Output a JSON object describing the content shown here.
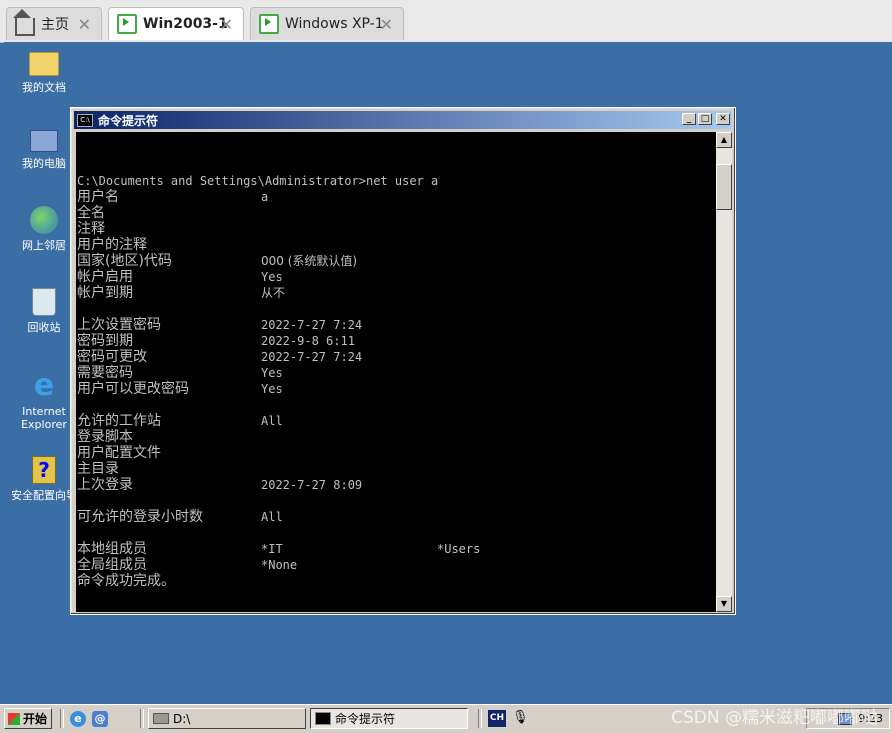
{
  "vm_tabs": [
    {
      "label": "主页",
      "icon": "home-icon",
      "active": false
    },
    {
      "label": "Win2003-1",
      "icon": "vm-icon",
      "active": true
    },
    {
      "label": "Windows XP-1",
      "icon": "vm-icon",
      "active": false
    }
  ],
  "desktop_icons": [
    {
      "label": "我的文档",
      "icon": "my-documents-icon"
    },
    {
      "label": "我的电脑",
      "icon": "my-computer-icon"
    },
    {
      "label": "网上邻居",
      "icon": "network-places-icon"
    },
    {
      "label": "回收站",
      "icon": "recycle-bin-icon"
    },
    {
      "label": "Internet Explorer",
      "icon": "internet-explorer-icon"
    },
    {
      "label": "安全配置向导",
      "icon": "security-wizard-icon"
    }
  ],
  "cmd": {
    "title": "命令提示符",
    "icon_text": "C:\\",
    "prompt_line": "C:\\Documents and Settings\\Administrator>net user a",
    "rows": [
      {
        "label": "用户名",
        "value": "a"
      },
      {
        "label": "全名",
        "value": ""
      },
      {
        "label": "注释",
        "value": ""
      },
      {
        "label": "用户的注释",
        "value": ""
      },
      {
        "label": "国家(地区)代码",
        "value": "000 (系统默认值)"
      },
      {
        "label": "帐户启用",
        "value": "Yes"
      },
      {
        "label": "帐户到期",
        "value": "从不"
      },
      {
        "label": "",
        "value": ""
      },
      {
        "label": "上次设置密码",
        "value": "2022-7-27 7:24"
      },
      {
        "label": "密码到期",
        "value": "2022-9-8 6:11"
      },
      {
        "label": "密码可更改",
        "value": "2022-7-27 7:24"
      },
      {
        "label": "需要密码",
        "value": "Yes"
      },
      {
        "label": "用户可以更改密码",
        "value": "Yes"
      },
      {
        "label": "",
        "value": ""
      },
      {
        "label": "允许的工作站",
        "value": "All"
      },
      {
        "label": "登录脚本",
        "value": ""
      },
      {
        "label": "用户配置文件",
        "value": ""
      },
      {
        "label": "主目录",
        "value": ""
      },
      {
        "label": "上次登录",
        "value": "2022-7-27 8:09"
      },
      {
        "label": "",
        "value": ""
      },
      {
        "label": "可允许的登录小时数",
        "value": "All"
      },
      {
        "label": "",
        "value": ""
      },
      {
        "label": "本地组成员",
        "value": "*IT",
        "value2": "*Users"
      },
      {
        "label": "全局组成员",
        "value": "*None"
      },
      {
        "label": "命令成功完成。",
        "value": ""
      }
    ]
  },
  "taskbar": {
    "start_label": "开始",
    "buttons": [
      {
        "label": "D:\\",
        "icon": "drive-icon"
      },
      {
        "label": "命令提示符",
        "icon": "cmd-icon"
      }
    ],
    "ime": "CH",
    "clock": "9:23"
  },
  "watermark": "CSDN @糯米滋粑嘟嘟嘟哒"
}
